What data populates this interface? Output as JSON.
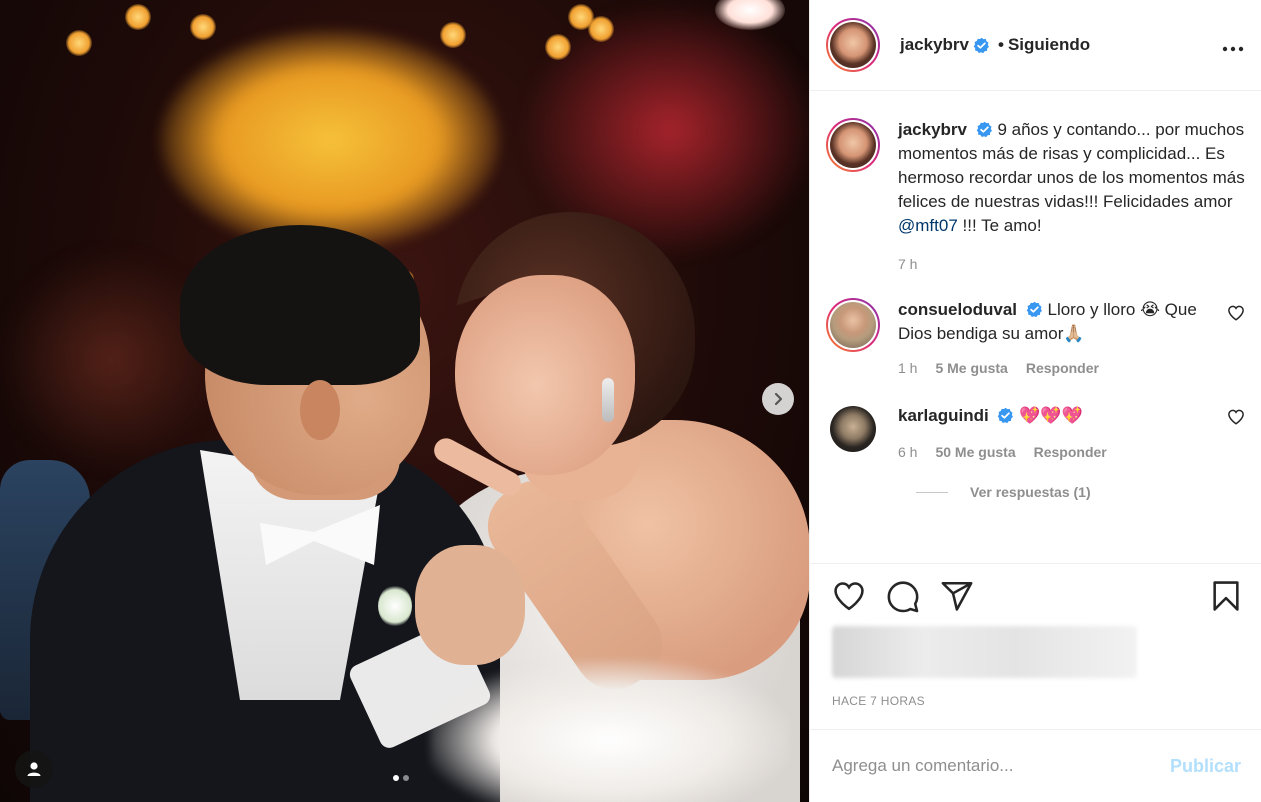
{
  "post": {
    "image_alt": "",
    "carousel": {
      "total": 2,
      "current": 1
    }
  },
  "header": {
    "username": "jackybrv",
    "separator": "•",
    "follow_status": "Siguiendo"
  },
  "caption": {
    "username": "jackybrv",
    "text_before": "9 años y contando... por muchos momentos más de risas y complicidad... Es hermoso recordar unos de los momentos más felices de nuestras vidas!!! Felicidades amor",
    "mention": "@mft07",
    "text_after": "!!! Te amo!",
    "time": "7 h"
  },
  "comments": [
    {
      "username": "consueloduval",
      "text": "Lloro y lloro 😭 Que Dios bendiga su amor🙏🏼",
      "time": "1 h",
      "likes": "5 Me gusta",
      "reply": "Responder"
    },
    {
      "username": "karlaguindi",
      "text": "💖💖💖",
      "time": "6 h",
      "likes": "50 Me gusta",
      "reply": "Responder",
      "replies_label": "Ver respuestas (1)"
    }
  ],
  "footer": {
    "timestamp": "HACE 7 HORAS",
    "comment_placeholder": "Agrega un comentario...",
    "publish_label": "Publicar"
  },
  "colors": {
    "verified": "#3897f0",
    "link": "#00376b",
    "publish_disabled": "#b2dffc",
    "muted": "#8e8e8e"
  }
}
